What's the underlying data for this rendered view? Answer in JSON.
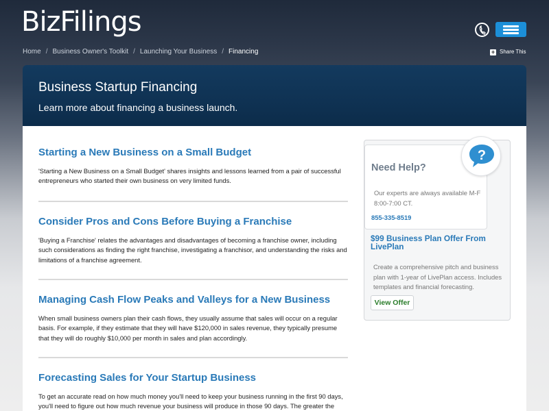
{
  "header": {
    "logo": "BizFilings",
    "phone_icon": "phone-icon",
    "menu_icon": "hamburger-menu-icon",
    "accent_color": "#1c8fd8"
  },
  "breadcrumb": {
    "items": [
      "Home",
      "Business Owner's Toolkit",
      "Launching Your Business"
    ],
    "current": "Financing",
    "separator": "/"
  },
  "share": {
    "icon": "plus-icon",
    "label": "Share This"
  },
  "banner": {
    "title": "Business Startup Financing",
    "subtitle": "Learn more about financing a business launch."
  },
  "articles": [
    {
      "title": "Starting a New Business on a Small Budget",
      "summary": "'Starting a New Business on a Small Budget' shares insights and lessons learned from a pair of successful entrepreneurs who started their own business on very limited funds."
    },
    {
      "title": "Consider Pros and Cons Before Buying a Franchise",
      "summary": "'Buying a Franchise' relates the advantages and disadvantages of becoming a franchise owner, including such considerations as finding the right franchise, investigating a franchisor, and understanding the risks and limitations of a franchise agreement."
    },
    {
      "title": "Managing Cash Flow Peaks and Valleys for a New Business",
      "summary": "When small business owners plan their cash flows, they usually assume that sales will occur on a regular basis. For example, if they estimate that they will have $120,000 in sales revenue, they typically presume that they will do roughly $10,000 per month in sales and plan accordingly."
    },
    {
      "title": "Forecasting Sales for Your Startup Business",
      "summary": "To get an accurate read on how much money you'll need to keep your business running in the first 90 days, you'll need to figure out how much revenue your business will produce in those 90 days. The greater the"
    }
  ],
  "sidebar": {
    "help_title": "Need Help?",
    "help_icon": "question-bubble-icon",
    "help_text": "Our experts are always available M-F 8:00-7:00 CT.",
    "phone": "855-335-8519",
    "offer_title": "$99 Business Plan Offer From LivePlan",
    "offer_text": "Create a comprehensive pitch and business plan with 1-year of LivePlan access. Includes templates and financial forecasting.",
    "offer_button": "View Offer"
  }
}
